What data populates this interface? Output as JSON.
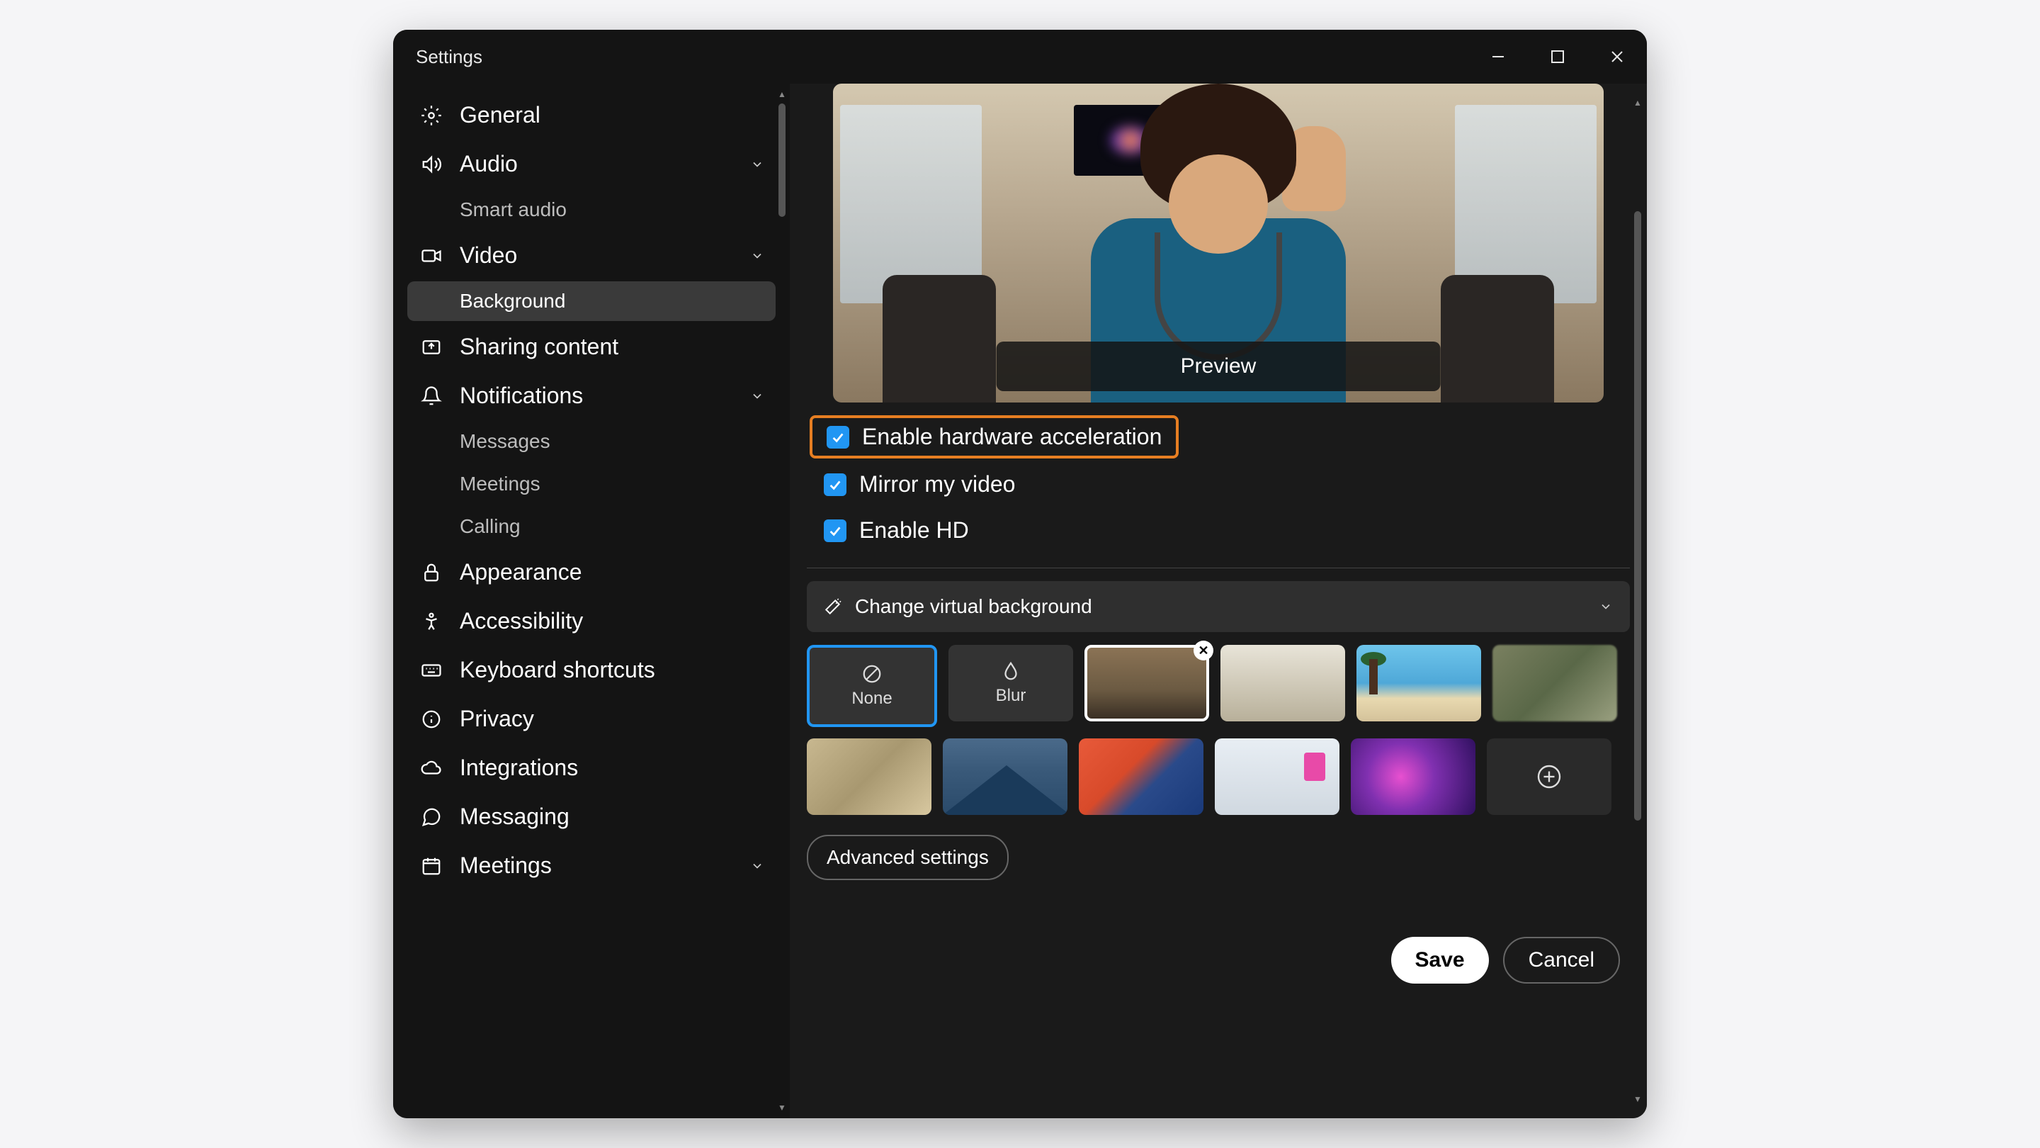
{
  "window": {
    "title": "Settings"
  },
  "sidebar": {
    "general": "General",
    "audio": "Audio",
    "smart_audio": "Smart audio",
    "video": "Video",
    "background": "Background",
    "sharing": "Sharing content",
    "notifications": "Notifications",
    "messages": "Messages",
    "meetings_sub": "Meetings",
    "calling": "Calling",
    "appearance": "Appearance",
    "accessibility": "Accessibility",
    "keyboard": "Keyboard shortcuts",
    "privacy": "Privacy",
    "integrations": "Integrations",
    "messaging": "Messaging",
    "meetings": "Meetings"
  },
  "content": {
    "preview_button": "Preview",
    "checkbox_hw": "Enable hardware acceleration",
    "checkbox_mirror": "Mirror my video",
    "checkbox_hd": "Enable HD",
    "change_bg": "Change virtual background",
    "tile_none": "None",
    "tile_blur": "Blur",
    "advanced": "Advanced settings"
  },
  "footer": {
    "save": "Save",
    "cancel": "Cancel"
  }
}
